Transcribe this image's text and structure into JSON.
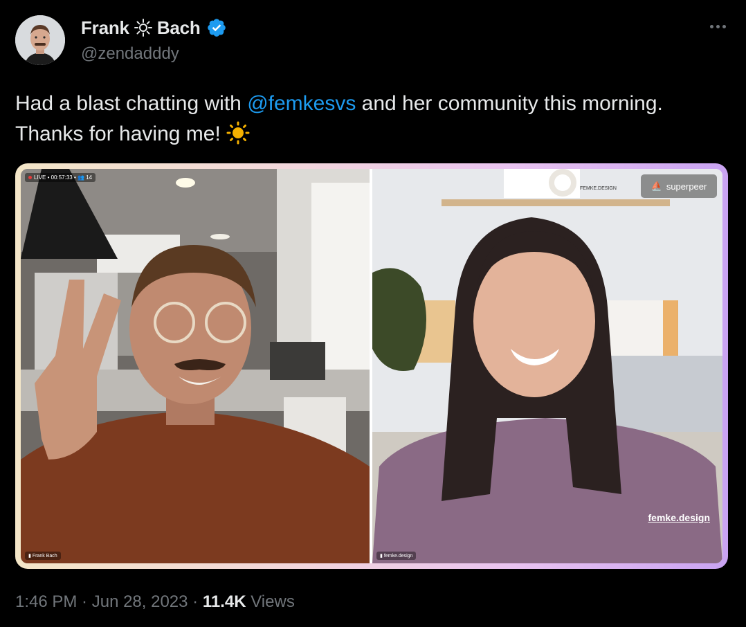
{
  "author": {
    "name_first": "Frank",
    "name_last": "Bach",
    "handle": "@zendadddy",
    "verified": true,
    "accent_color": "#1d9bf0"
  },
  "tweet": {
    "text_before": "Had a blast chatting with ",
    "mention": "@femkesvs",
    "text_after": " and her community this morning.",
    "line2": "Thanks for having me! ",
    "emoji": "☀️"
  },
  "media": {
    "left_frame": {
      "live_status": "LIVE • 00:57:33 • 👥 14",
      "name_tag": "Frank Bach"
    },
    "right_frame": {
      "brand_badge": "superpeer",
      "watermark": "femke.design",
      "shelf_sign": "FEMKE.DESIGN",
      "name_tag": "femke.design"
    }
  },
  "footer": {
    "time": "1:46 PM",
    "separator": " · ",
    "date": "Jun 28, 2023",
    "views_count": "11.4K",
    "views_label": " Views"
  }
}
